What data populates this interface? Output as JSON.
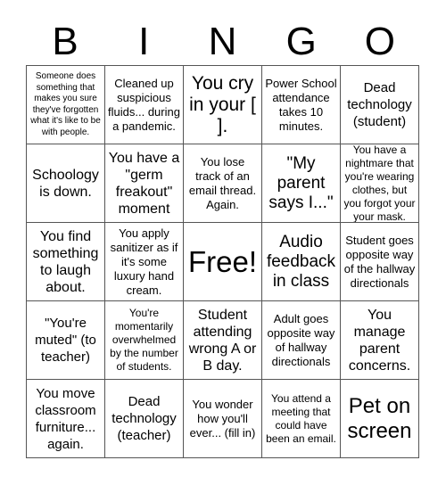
{
  "header": {
    "letters": [
      "B",
      "I",
      "N",
      "G",
      "O"
    ]
  },
  "cells": [
    "Someone does something that makes you sure they've forgotten what it's like to be with people.",
    "Cleaned up suspicious fluids... during a pandemic.",
    "You cry in your [ ].",
    "Power School attendance takes 10 minutes.",
    "Dead technology (student)",
    "Schoology is down.",
    "You have a \"germ freakout\" moment",
    "You lose track of an email thread. Again.",
    "\"My parent says I...\"",
    "You have a nightmare that you're wearing clothes, but you forgot your your mask.",
    "You find something to laugh about.",
    "You apply sanitizer as if it's some luxury hand cream.",
    "Free!",
    "Audio feedback in class",
    "Student goes opposite way of the hallway directionals",
    "\"You're muted\" (to teacher)",
    "You're momentarily overwhelmed by the number of students.",
    "Student attending wrong A or B day.",
    "Adult goes opposite way of hallway directionals",
    "You manage parent concerns.",
    "You move classroom furniture... again.",
    "Dead technology (teacher)",
    "You wonder how you'll ever... (fill in)",
    "You attend a meeting that could have been an email.",
    "Pet on screen"
  ]
}
